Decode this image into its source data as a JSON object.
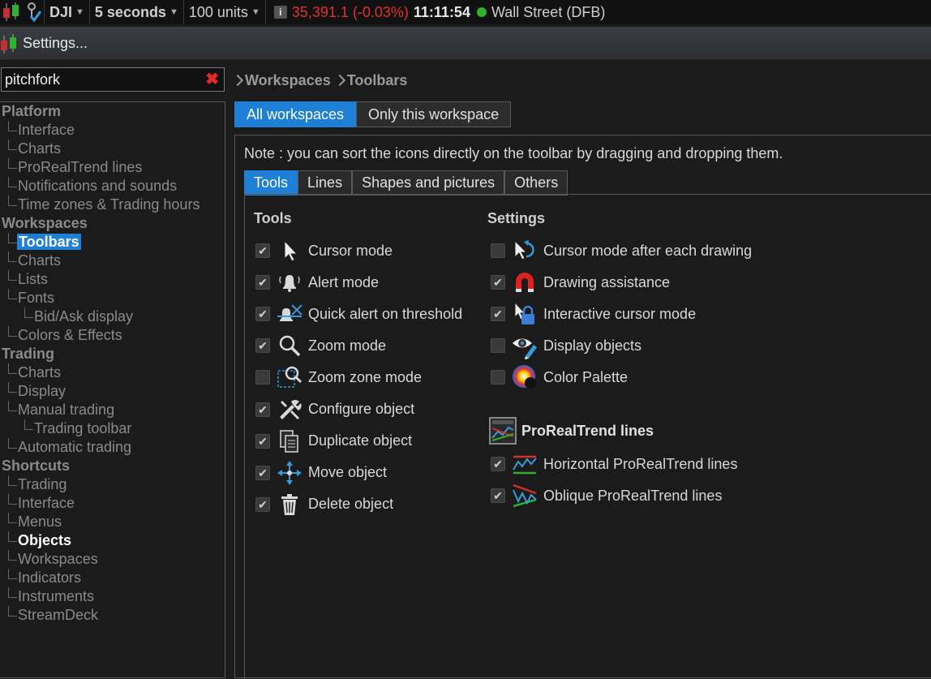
{
  "topbar": {
    "instrument": "DJI",
    "interval": "5 seconds",
    "units": "100 units",
    "price": "35,391.1 (-0.03%)",
    "time": "11:11:54",
    "market": "Wall Street (DFB)",
    "info": "i"
  },
  "window": {
    "title": "Settings..."
  },
  "search": {
    "value": "pitchfork"
  },
  "tree": [
    {
      "type": "section",
      "label": "Platform"
    },
    {
      "type": "item",
      "label": "Interface"
    },
    {
      "type": "item",
      "label": "Charts"
    },
    {
      "type": "item",
      "label": "ProRealTrend lines"
    },
    {
      "type": "item",
      "label": "Notifications and sounds"
    },
    {
      "type": "item",
      "label": "Time zones & Trading hours"
    },
    {
      "type": "section",
      "label": "Workspaces"
    },
    {
      "type": "item",
      "label": "Toolbars",
      "state": "selected"
    },
    {
      "type": "item",
      "label": "Charts"
    },
    {
      "type": "item",
      "label": "Lists"
    },
    {
      "type": "item",
      "label": "Fonts"
    },
    {
      "type": "sub",
      "label": "Bid/Ask display"
    },
    {
      "type": "item",
      "label": "Colors & Effects"
    },
    {
      "type": "section",
      "label": "Trading"
    },
    {
      "type": "item",
      "label": "Charts"
    },
    {
      "type": "item",
      "label": "Display"
    },
    {
      "type": "item",
      "label": "Manual trading"
    },
    {
      "type": "sub",
      "label": "Trading toolbar"
    },
    {
      "type": "item",
      "label": "Automatic trading"
    },
    {
      "type": "section",
      "label": "Shortcuts"
    },
    {
      "type": "item",
      "label": "Trading"
    },
    {
      "type": "item",
      "label": "Interface"
    },
    {
      "type": "item",
      "label": "Menus"
    },
    {
      "type": "item",
      "label": "Objects",
      "state": "bold"
    },
    {
      "type": "item",
      "label": "Workspaces"
    },
    {
      "type": "item",
      "label": "Indicators"
    },
    {
      "type": "item",
      "label": "Instruments"
    },
    {
      "type": "item",
      "label": "StreamDeck"
    }
  ],
  "breadcrumb": [
    "Workspaces",
    "Toolbars"
  ],
  "workspace_tabs": [
    {
      "label": "All workspaces",
      "active": true
    },
    {
      "label": "Only this workspace",
      "active": false
    }
  ],
  "note": "Note : you can sort the icons directly on the toolbar by dragging and dropping them.",
  "sub_tabs": [
    {
      "label": "Tools",
      "active": true
    },
    {
      "label": "Lines",
      "active": false
    },
    {
      "label": "Shapes and pictures",
      "active": false
    },
    {
      "label": "Others",
      "active": false
    }
  ],
  "tools": {
    "title": "Tools",
    "items": [
      {
        "label": "Cursor mode",
        "checked": true,
        "icon": "cursor-icon"
      },
      {
        "label": "Alert mode",
        "checked": true,
        "icon": "bell-icon"
      },
      {
        "label": "Quick alert on threshold",
        "checked": true,
        "icon": "bell-threshold-icon"
      },
      {
        "label": "Zoom mode",
        "checked": true,
        "icon": "magnifier-icon"
      },
      {
        "label": "Zoom zone mode",
        "checked": false,
        "icon": "zoom-zone-icon"
      },
      {
        "label": "Configure object",
        "checked": true,
        "icon": "tools-icon"
      },
      {
        "label": "Duplicate object",
        "checked": true,
        "icon": "duplicate-icon"
      },
      {
        "label": "Move object",
        "checked": true,
        "icon": "move-icon"
      },
      {
        "label": "Delete object",
        "checked": true,
        "icon": "trash-icon"
      }
    ]
  },
  "settings": {
    "title": "Settings",
    "items": [
      {
        "label": "Cursor mode after each drawing",
        "checked": false,
        "icon": "cursor-return-icon"
      },
      {
        "label": "Drawing assistance",
        "checked": true,
        "icon": "magnet-icon"
      },
      {
        "label": "Interactive cursor mode",
        "checked": true,
        "icon": "lock-cursor-icon"
      },
      {
        "label": "Display objects",
        "checked": false,
        "icon": "eye-pencil-icon"
      },
      {
        "label": "Color Palette",
        "checked": false,
        "icon": "color-wheel-icon"
      }
    ]
  },
  "prorealtrend": {
    "title": "ProRealTrend lines",
    "icon": "prorealtrend-icon",
    "items": [
      {
        "label": "Horizontal ProRealTrend lines",
        "checked": true,
        "icon": "horizontal-trend-icon"
      },
      {
        "label": "Oblique ProRealTrend lines",
        "checked": true,
        "icon": "oblique-trend-icon"
      }
    ]
  },
  "colors": {
    "accent": "#1e7fd6",
    "price_down": "#e03030",
    "market_open": "#2fb02f",
    "clear": "#e8292c"
  }
}
